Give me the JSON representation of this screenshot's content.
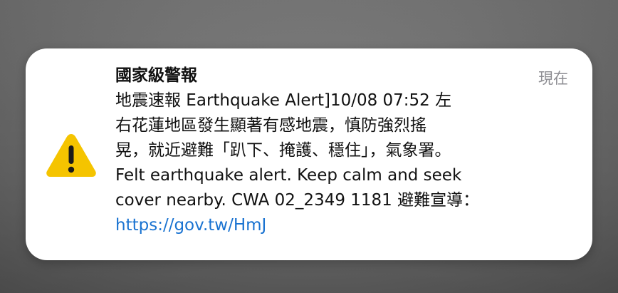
{
  "notification": {
    "title": "國家級警報",
    "timestamp": "現在",
    "icon": "warning-triangle-icon",
    "message_lines": [
      "地震速報 Earthquake Alert]10/08 07:52 左",
      "右花蓮地區發生顯著有感地震，慎防強烈搖",
      "晃，就近避難「趴下、掩護、穩住」，氣象署。",
      "Felt earthquake alert. Keep calm and seek",
      "cover nearby. CWA 02_2349 1181 避難宣導："
    ],
    "link": "https://gov.tw/HmJ"
  },
  "colors": {
    "card_background": "#ffffff",
    "warning_yellow": "#f5c400",
    "link_blue": "#1a73d1",
    "timestamp_gray": "#8e8e93"
  }
}
